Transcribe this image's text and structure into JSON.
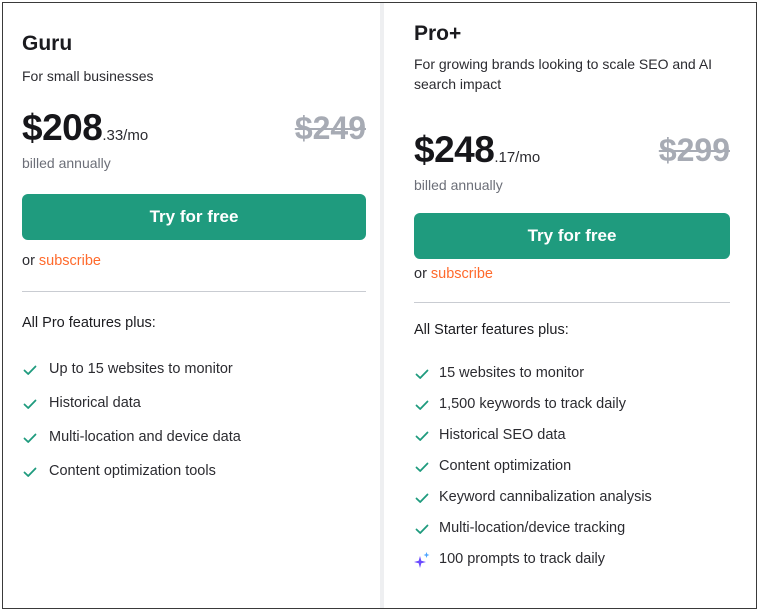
{
  "plans": [
    {
      "name": "Guru",
      "description": "For small businesses",
      "price_whole": "$208",
      "price_fraction": ".33/mo",
      "price_old": "$249",
      "billing_note": "billed annually",
      "cta_label": "Try for free",
      "alt_prefix": "or ",
      "alt_link": "subscribe",
      "features_title": "All Pro features plus:",
      "features": [
        {
          "icon": "check-icon",
          "label": "Up to 15 websites to monitor"
        },
        {
          "icon": "check-icon",
          "label": "Historical data"
        },
        {
          "icon": "check-icon",
          "label": "Multi-location and device data"
        },
        {
          "icon": "check-icon",
          "label": "Content optimization tools"
        }
      ]
    },
    {
      "name": "Pro+",
      "description": "For growing brands looking to scale SEO and AI search impact",
      "price_whole": "$248",
      "price_fraction": ".17/mo",
      "price_old": "$299",
      "billing_note": "billed annually",
      "cta_label": "Try for free",
      "alt_prefix": "or ",
      "alt_link": "subscribe",
      "features_title": "All Starter features plus:",
      "features": [
        {
          "icon": "check-icon",
          "label": "15 websites to monitor"
        },
        {
          "icon": "check-icon",
          "label": "1,500 keywords to track daily"
        },
        {
          "icon": "check-icon",
          "label": "Historical SEO data"
        },
        {
          "icon": "check-icon",
          "label": "Content optimization"
        },
        {
          "icon": "check-icon",
          "label": "Keyword cannibalization analysis"
        },
        {
          "icon": "check-icon",
          "label": "Multi-location/device tracking"
        },
        {
          "icon": "sparkle-icon",
          "label": "100 prompts to track daily"
        }
      ]
    }
  ],
  "colors": {
    "accent_green": "#1f9b7e",
    "link_orange": "#ff6a2c",
    "old_price_gray": "#a7abb4",
    "sparkle_purple": "#6b4bff"
  }
}
